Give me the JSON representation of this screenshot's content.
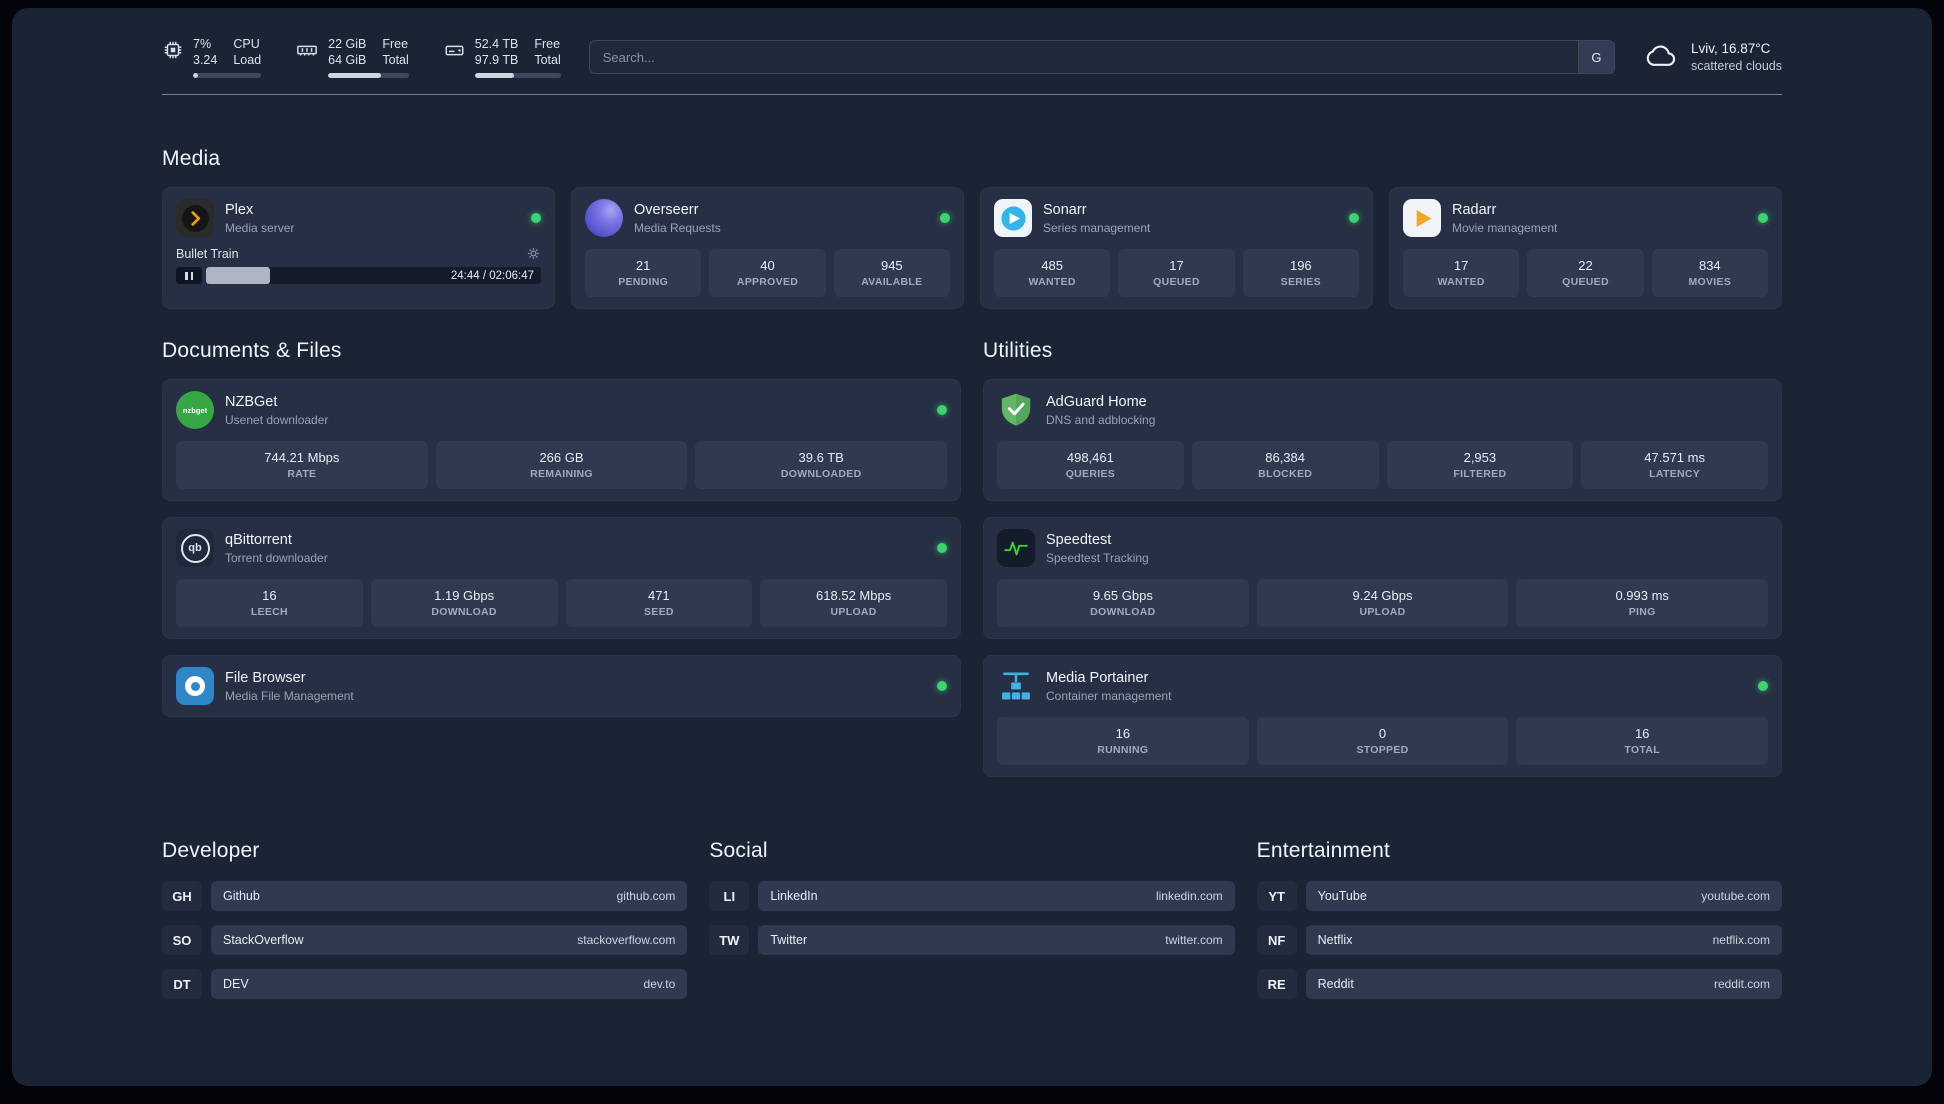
{
  "colors": {
    "status_online": "#3dd272",
    "plex_accent": "#e5a00d",
    "overseerr_accent": "#5f5cd4",
    "sonarr_accent": "#33b5e9",
    "radarr_accent": "#f5a623",
    "nzbget_accent": "#37a644",
    "adguard_accent": "#62b766",
    "speedtest_accent": "#35d42e",
    "portainer_accent": "#3fb2e3"
  },
  "topbar": {
    "cpu": {
      "usage": "7%",
      "load": "3.24",
      "usage_label": "CPU",
      "load_label": "Load",
      "progress_pct": 7
    },
    "memory": {
      "free": "22 GiB",
      "total": "64 GiB",
      "free_label": "Free",
      "total_label": "Total",
      "progress_pct": 66
    },
    "storage": {
      "free": "52.4 TB",
      "total": "97.9 TB",
      "free_label": "Free",
      "total_label": "Total",
      "progress_pct": 46
    },
    "search": {
      "placeholder": "Search...",
      "engine_button": "G"
    },
    "weather": {
      "location": "Lviv, 16.87°C",
      "condition": "scattered clouds"
    }
  },
  "media": {
    "title": "Media",
    "plex": {
      "name": "Plex",
      "subtitle": "Media server",
      "now_playing": "Bullet Train",
      "elapsed": "24:44 / 02:06:47",
      "progress_pct": 19
    },
    "overseerr": {
      "name": "Overseerr",
      "subtitle": "Media Requests",
      "stats": [
        {
          "value": "21",
          "label": "PENDING"
        },
        {
          "value": "40",
          "label": "APPROVED"
        },
        {
          "value": "945",
          "label": "AVAILABLE"
        }
      ]
    },
    "sonarr": {
      "name": "Sonarr",
      "subtitle": "Series management",
      "stats": [
        {
          "value": "485",
          "label": "WANTED"
        },
        {
          "value": "17",
          "label": "QUEUED"
        },
        {
          "value": "196",
          "label": "SERIES"
        }
      ]
    },
    "radarr": {
      "name": "Radarr",
      "subtitle": "Movie management",
      "stats": [
        {
          "value": "17",
          "label": "WANTED"
        },
        {
          "value": "22",
          "label": "QUEUED"
        },
        {
          "value": "834",
          "label": "MOVIES"
        }
      ]
    }
  },
  "documents": {
    "title": "Documents & Files",
    "nzbget": {
      "name": "NZBGet",
      "subtitle": "Usenet downloader",
      "stats": [
        {
          "value": "744.21 Mbps",
          "label": "RATE"
        },
        {
          "value": "266 GB",
          "label": "REMAINING"
        },
        {
          "value": "39.6 TB",
          "label": "DOWNLOADED"
        }
      ]
    },
    "qbittorrent": {
      "name": "qBittorrent",
      "subtitle": "Torrent downloader",
      "stats": [
        {
          "value": "16",
          "label": "LEECH"
        },
        {
          "value": "1.19 Gbps",
          "label": "DOWNLOAD"
        },
        {
          "value": "471",
          "label": "SEED"
        },
        {
          "value": "618.52 Mbps",
          "label": "UPLOAD"
        }
      ]
    },
    "filebrowser": {
      "name": "File Browser",
      "subtitle": "Media File Management"
    }
  },
  "utilities": {
    "title": "Utilities",
    "adguard": {
      "name": "AdGuard Home",
      "subtitle": "DNS and adblocking",
      "stats": [
        {
          "value": "498,461",
          "label": "QUERIES"
        },
        {
          "value": "86,384",
          "label": "BLOCKED"
        },
        {
          "value": "2,953",
          "label": "FILTERED"
        },
        {
          "value": "47.571 ms",
          "label": "LATENCY"
        }
      ]
    },
    "speedtest": {
      "name": "Speedtest",
      "subtitle": "Speedtest Tracking",
      "stats": [
        {
          "value": "9.65 Gbps",
          "label": "DOWNLOAD"
        },
        {
          "value": "9.24 Gbps",
          "label": "UPLOAD"
        },
        {
          "value": "0.993 ms",
          "label": "PING"
        }
      ]
    },
    "portainer": {
      "name": "Media Portainer",
      "subtitle": "Container management",
      "stats": [
        {
          "value": "16",
          "label": "RUNNING"
        },
        {
          "value": "0",
          "label": "STOPPED"
        },
        {
          "value": "16",
          "label": "TOTAL"
        }
      ]
    }
  },
  "bookmarks": {
    "developer": {
      "title": "Developer",
      "items": [
        {
          "abbr": "GH",
          "name": "Github",
          "url": "github.com"
        },
        {
          "abbr": "SO",
          "name": "StackOverflow",
          "url": "stackoverflow.com"
        },
        {
          "abbr": "DT",
          "name": "DEV",
          "url": "dev.to"
        }
      ]
    },
    "social": {
      "title": "Social",
      "items": [
        {
          "abbr": "LI",
          "name": "LinkedIn",
          "url": "linkedin.com"
        },
        {
          "abbr": "TW",
          "name": "Twitter",
          "url": "twitter.com"
        }
      ]
    },
    "entertainment": {
      "title": "Entertainment",
      "items": [
        {
          "abbr": "YT",
          "name": "YouTube",
          "url": "youtube.com"
        },
        {
          "abbr": "NF",
          "name": "Netflix",
          "url": "netflix.com"
        },
        {
          "abbr": "RE",
          "name": "Reddit",
          "url": "reddit.com"
        }
      ]
    }
  },
  "icons": {
    "qbittorrent_text": "qb",
    "nzbget_text": "nzbget"
  }
}
